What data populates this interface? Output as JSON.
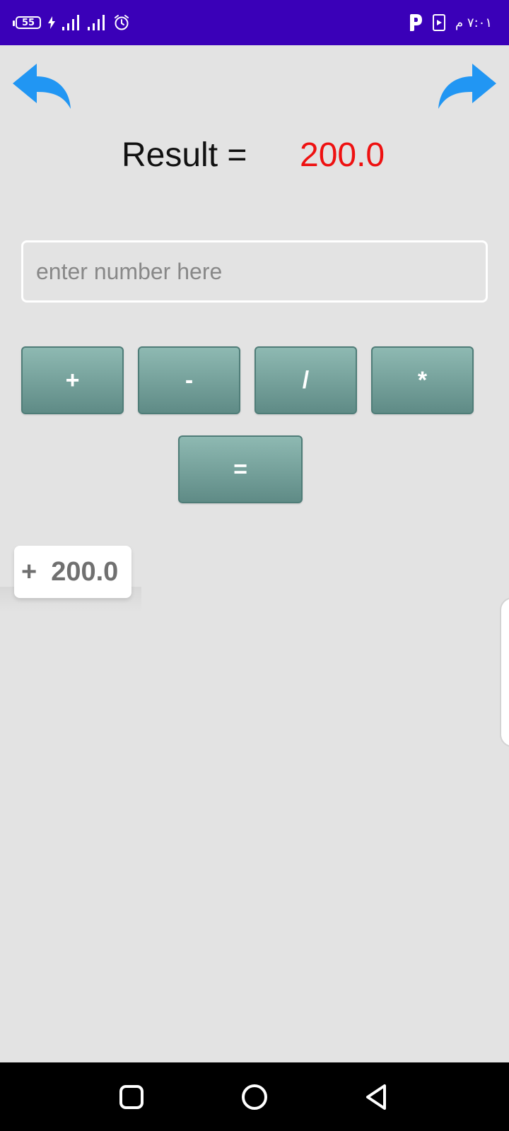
{
  "status_bar": {
    "battery_level": "55",
    "time": "٧:٠١ م",
    "background_color": "#3a00b8",
    "icons": [
      "battery-icon",
      "charging-bolt-icon",
      "signal-bars-icon",
      "signal-bars-icon",
      "alarm-clock-icon",
      "parking-app-icon",
      "media-play-icon"
    ]
  },
  "toolbar": {
    "undo_icon": "undo-arrow-icon",
    "redo_icon": "redo-arrow-icon",
    "arrow_color": "#2196f3"
  },
  "result": {
    "label": "Result =",
    "value": "200.0",
    "value_color": "#ee1111"
  },
  "input": {
    "placeholder": "enter number here",
    "value": ""
  },
  "operators": {
    "plus": "+",
    "minus": "-",
    "divide": "/",
    "multiply": "*",
    "equals": "="
  },
  "history": {
    "operator": "+",
    "value": "200.0"
  },
  "nav_bar": {
    "icons": [
      "recent-apps-icon",
      "home-icon",
      "back-icon"
    ]
  }
}
